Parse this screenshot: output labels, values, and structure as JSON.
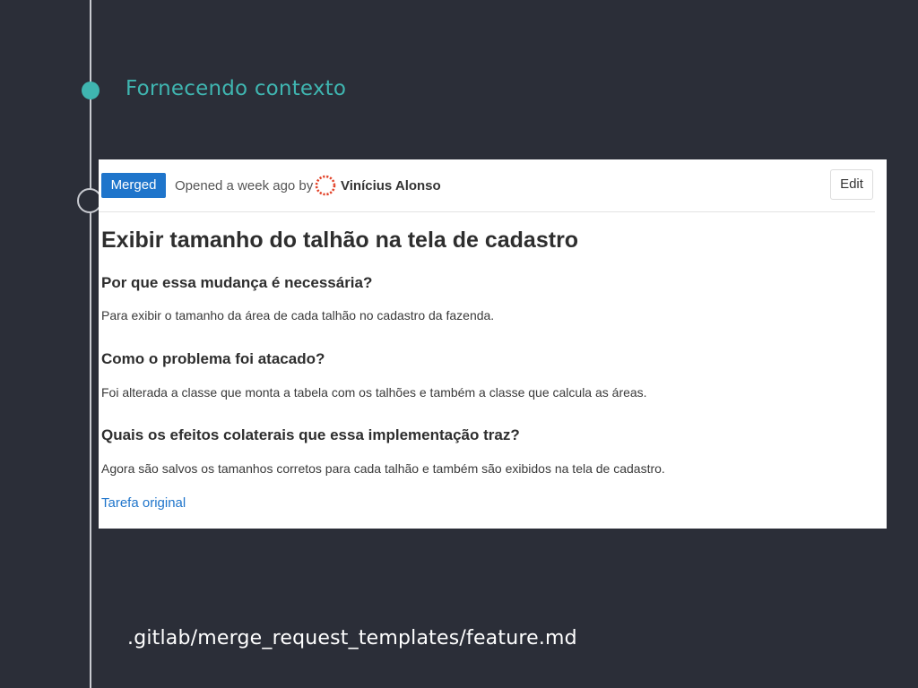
{
  "slide": {
    "title": "Fornecendo contexto",
    "file_path": ".gitlab/merge_request_templates/feature.md"
  },
  "merge_request": {
    "status_badge": "Merged",
    "opened_text": "Opened a week ago by",
    "author": "Vinícius Alonso",
    "edit_label": "Edit",
    "title": "Exibir tamanho do talhão na tela de cadastro",
    "sections": [
      {
        "heading": "Por que essa mudança é necessária?",
        "body": "Para exibir o tamanho da área de cada talhão no cadastro da fazenda."
      },
      {
        "heading": "Como o problema foi atacado?",
        "body": "Foi alterada a classe que monta a tabela com os talhões e também a classe que calcula as áreas."
      },
      {
        "heading": "Quais os efeitos colaterais que essa implementação traz?",
        "body": "Agora são salvos os tamanhos corretos para cada talhão e também são exibidos na tela de cadastro."
      }
    ],
    "link_label": "Tarefa original"
  },
  "colors": {
    "background": "#2b2e38",
    "accent": "#3fb5b0",
    "badge": "#1f75cb",
    "link": "#1f75cb",
    "avatar": "#e24329"
  },
  "icons": {
    "avatar": "author-avatar-icon"
  }
}
